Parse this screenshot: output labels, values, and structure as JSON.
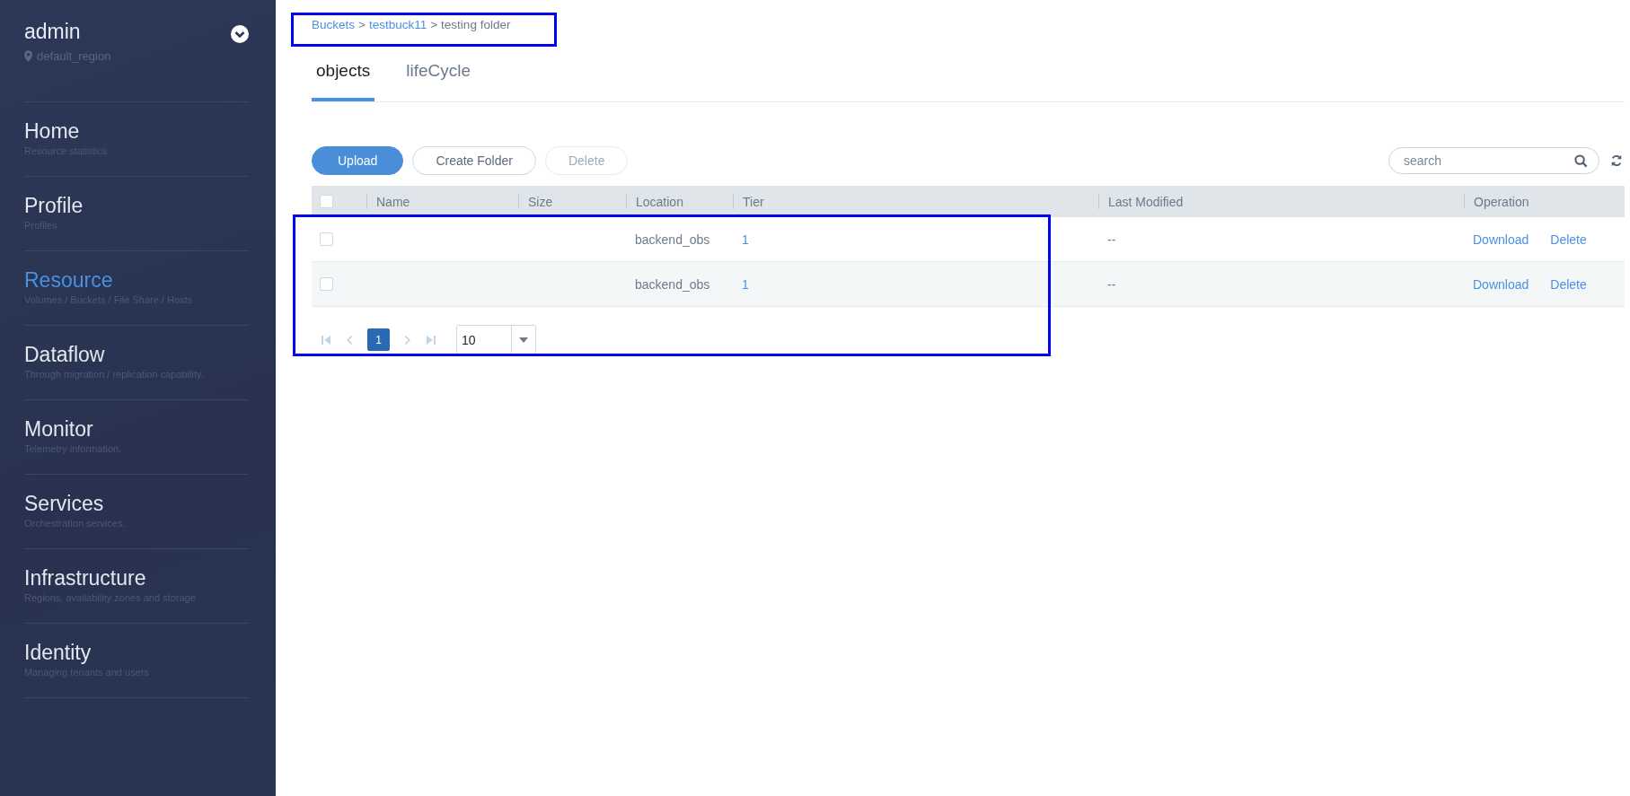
{
  "sidebar": {
    "user": "admin",
    "region": "default_region",
    "items": [
      {
        "title": "Home",
        "subtitle": "Resource statistics",
        "selected": false
      },
      {
        "title": "Profile",
        "subtitle": "Profiles",
        "selected": false
      },
      {
        "title": "Resource",
        "subtitle": "Volumes / Buckets / File Share / Hosts",
        "selected": true
      },
      {
        "title": "Dataflow",
        "subtitle": "Through migration / replication capability.",
        "selected": false
      },
      {
        "title": "Monitor",
        "subtitle": "Telemetry information.",
        "selected": false
      },
      {
        "title": "Services",
        "subtitle": "Orchestration services.",
        "selected": false
      },
      {
        "title": "Infrastructure",
        "subtitle": "Regions, availability zones and storage",
        "selected": false
      },
      {
        "title": "Identity",
        "subtitle": "Managing tenants and users",
        "selected": false
      }
    ]
  },
  "breadcrumb": [
    {
      "label": "Buckets",
      "kind": "link"
    },
    {
      "label": ">",
      "kind": "separator"
    },
    {
      "label": "testbuck11",
      "kind": "link"
    },
    {
      "label": ">",
      "kind": "separator"
    },
    {
      "label": "testing folder",
      "kind": "current"
    }
  ],
  "tabs": [
    {
      "label": "objects",
      "selected": true
    },
    {
      "label": "lifeCycle",
      "selected": false
    }
  ],
  "toolbar": {
    "buttons": [
      {
        "label": "Upload",
        "kind": "primary",
        "disabled": false
      },
      {
        "label": "Create Folder",
        "kind": "default",
        "disabled": false
      },
      {
        "label": "Delete",
        "kind": "default",
        "disabled": true
      }
    ],
    "search": {
      "placeholder": "search"
    }
  },
  "table": {
    "header_checked": false,
    "columns": [
      "Name",
      "Size",
      "Location",
      "Tier",
      "Last Modified",
      "Operation"
    ],
    "rows": [
      {
        "checked": false,
        "cells": [
          "",
          "",
          "backend_obs",
          "1",
          "--"
        ],
        "actions": [
          "Download",
          "Delete"
        ]
      },
      {
        "checked": false,
        "cells": [
          "",
          "",
          "backend_obs",
          "1",
          "--"
        ],
        "actions": [
          "Download",
          "Delete"
        ]
      }
    ]
  },
  "pagination": {
    "pages": [
      {
        "label": "1",
        "selected": true
      }
    ],
    "page_size": "10"
  },
  "highlight": {
    "breadcrumb": true,
    "rows": true
  }
}
